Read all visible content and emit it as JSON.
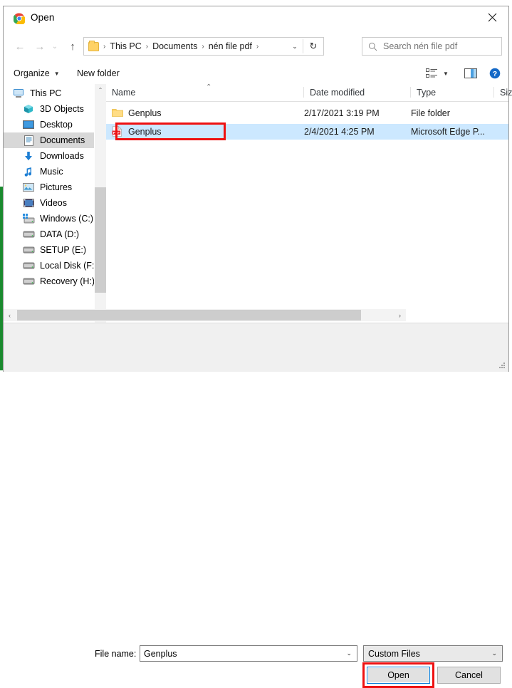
{
  "window": {
    "title": "Open",
    "app_icon": "chrome-icon",
    "close_label": "✕"
  },
  "nav": {
    "back": "←",
    "forward": "→",
    "recent": "⌄",
    "up": "↑",
    "refresh": "↻",
    "dropdown": "⌄"
  },
  "address": {
    "crumbs": [
      "This PC",
      "Documents",
      "nén file pdf"
    ],
    "separator": "›"
  },
  "search": {
    "placeholder": "Search nén file pdf",
    "icon": "search-icon"
  },
  "commandbar": {
    "organize": "Organize",
    "new_folder": "New folder",
    "caret": "▼",
    "view_icon": "view-list-icon",
    "pane_icon": "preview-pane-icon",
    "help_icon": "help-icon"
  },
  "sidebar": {
    "items": [
      {
        "label": "This PC",
        "icon": "computer-icon",
        "selected": false,
        "root": true
      },
      {
        "label": "3D Objects",
        "icon": "3d-objects-icon",
        "selected": false
      },
      {
        "label": "Desktop",
        "icon": "desktop-icon",
        "selected": false
      },
      {
        "label": "Documents",
        "icon": "documents-icon",
        "selected": true
      },
      {
        "label": "Downloads",
        "icon": "downloads-icon",
        "selected": false
      },
      {
        "label": "Music",
        "icon": "music-icon",
        "selected": false
      },
      {
        "label": "Pictures",
        "icon": "pictures-icon",
        "selected": false
      },
      {
        "label": "Videos",
        "icon": "videos-icon",
        "selected": false
      },
      {
        "label": "Windows (C:)",
        "icon": "windows-drive-icon",
        "selected": false
      },
      {
        "label": "DATA (D:)",
        "icon": "drive-icon",
        "selected": false
      },
      {
        "label": "SETUP (E:)",
        "icon": "drive-icon",
        "selected": false
      },
      {
        "label": "Local Disk (F:)",
        "icon": "drive-icon",
        "selected": false
      },
      {
        "label": "Recovery (H:)",
        "icon": "drive-icon",
        "selected": false
      }
    ],
    "scroll_up": "⌃",
    "scroll_down": "⌄"
  },
  "filelist": {
    "columns": [
      "Name",
      "Date modified",
      "Type",
      "Size"
    ],
    "sort_indicator": "⌃",
    "rows": [
      {
        "name": "Genplus",
        "date_modified": "2/17/2021 3:19 PM",
        "type": "File folder",
        "size": "",
        "icon": "folder-icon",
        "selected": false,
        "highlighted": false
      },
      {
        "name": "Genplus",
        "date_modified": "2/4/2021 4:25 PM",
        "type": "Microsoft Edge P...",
        "size": "",
        "icon": "pdf-icon",
        "selected": true,
        "highlighted": true
      }
    ],
    "hscroll_left": "‹",
    "hscroll_right": "›"
  },
  "footer": {
    "file_name_label": "File name:",
    "file_name_value": "Genplus",
    "filter_value": "Custom Files",
    "combo_caret": "⌄",
    "open_button": "Open",
    "cancel_button": "Cancel"
  },
  "colors": {
    "selection_blue": "#cce8ff",
    "annotation_red": "#ee1111",
    "focus_blue": "#0078d7",
    "accent_green": "#1a8a2e"
  }
}
